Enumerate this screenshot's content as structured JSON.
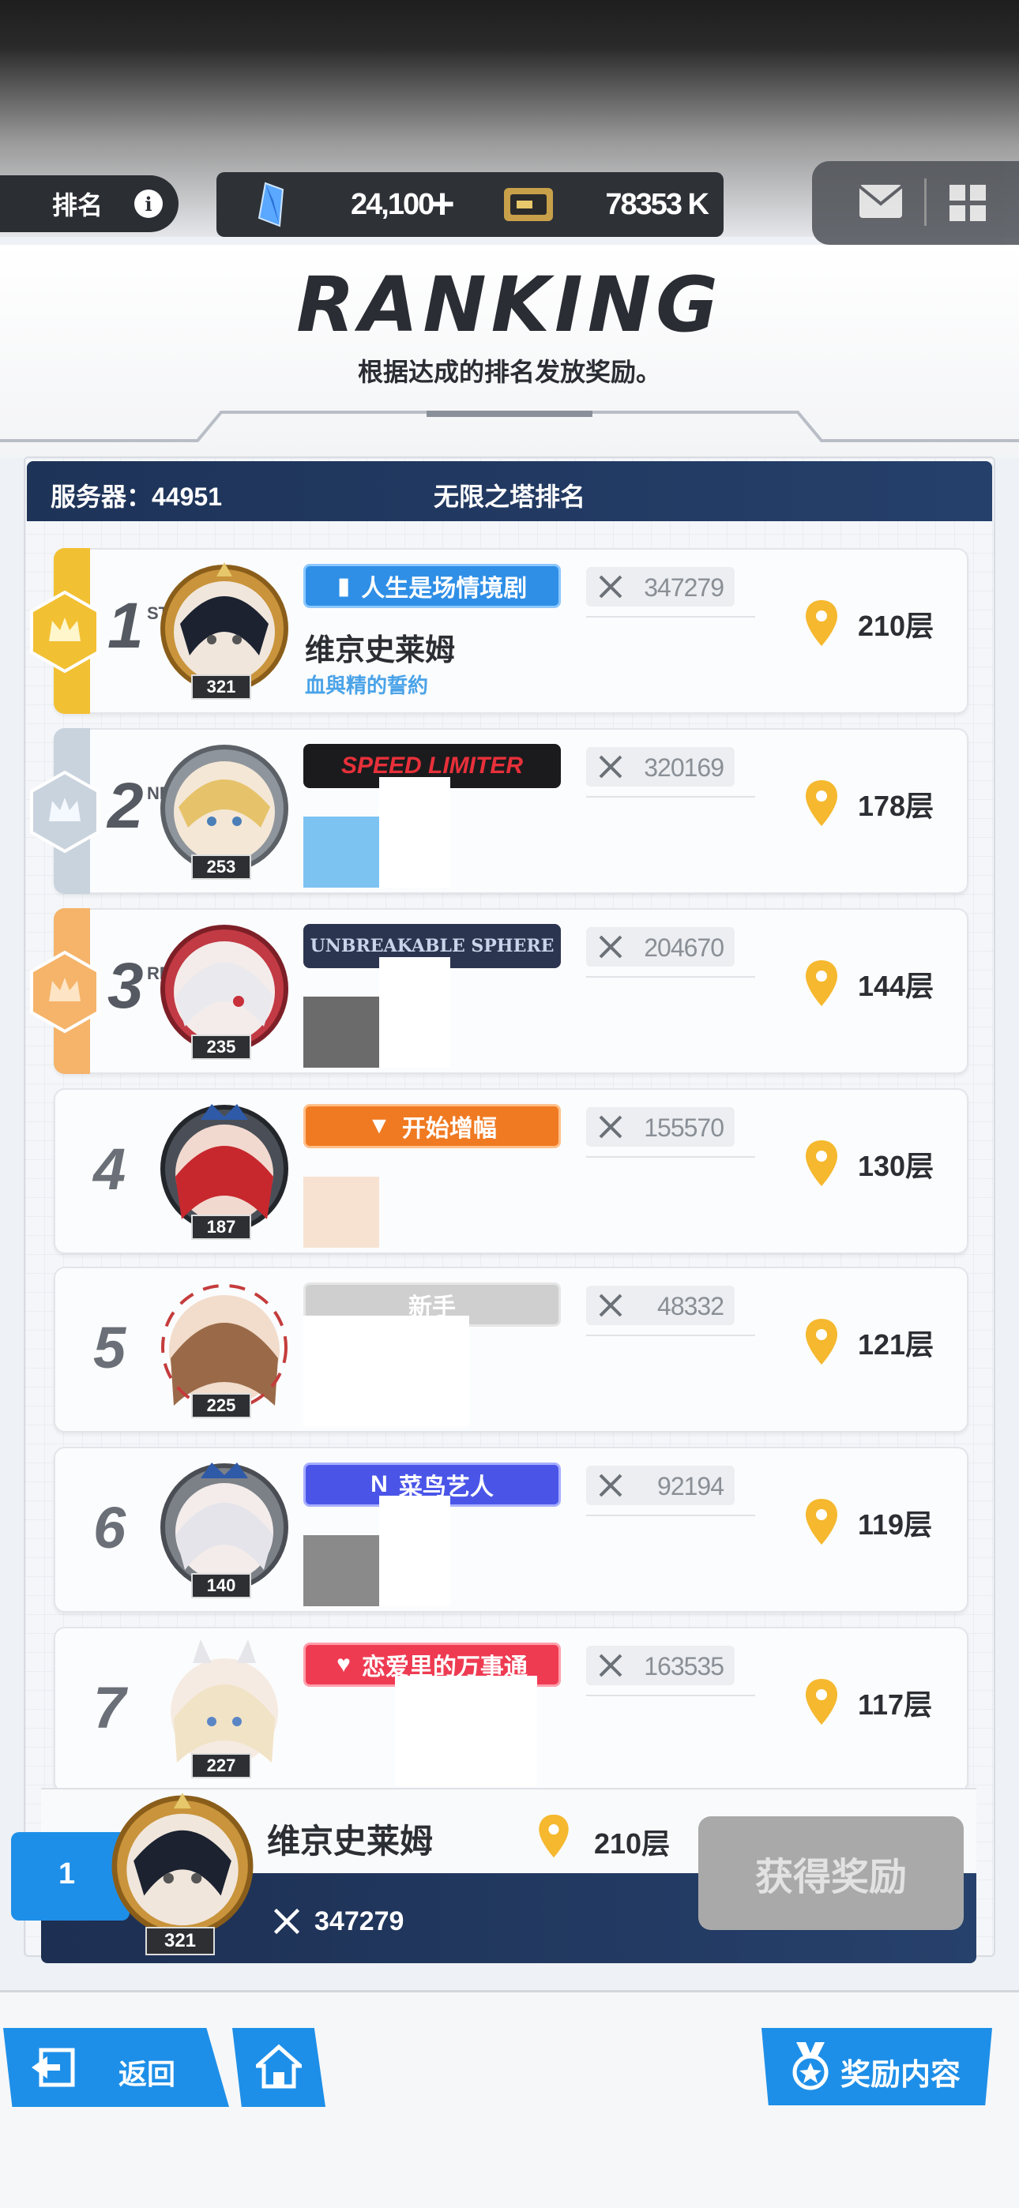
{
  "hud": {
    "rank_tab": "排名",
    "info_icon": "i",
    "gems": "24,100",
    "gems_plus": "+",
    "cards": "78353 K"
  },
  "header": {
    "title": "RANKING",
    "subtitle": "根据达成的排名发放奖励。"
  },
  "board": {
    "server": "服务器：44951",
    "title": "无限之塔排名"
  },
  "rows": [
    {
      "rank": "1",
      "sup": "ST",
      "level": "321",
      "badge": "人生是场情境剧",
      "power": "347279",
      "name": "维京史莱姆",
      "guild": "血與精的誓約",
      "floor": "210层"
    },
    {
      "rank": "2",
      "sup": "ND",
      "level": "253",
      "badge": "SPEED LIMITER",
      "power": "320169",
      "floor": "178层"
    },
    {
      "rank": "3",
      "sup": "RD",
      "level": "235",
      "badge": "UNBREAKABLE SPHERE",
      "power": "204670",
      "floor": "144层"
    },
    {
      "rank": "4",
      "level": "187",
      "badge": "开始增幅",
      "power": "155570",
      "floor": "130层"
    },
    {
      "rank": "5",
      "level": "225",
      "badge": "新手",
      "power": "48332",
      "floor": "121层"
    },
    {
      "rank": "6",
      "level": "140",
      "badge": "菜鸟艺人",
      "power": "92194",
      "floor": "119层"
    },
    {
      "rank": "7",
      "level": "227",
      "badge": "恋爱里的万事通",
      "power": "163535",
      "floor": "117层"
    }
  ],
  "self": {
    "rank": "1",
    "level": "321",
    "name": "维京史莱姆",
    "floor": "210层",
    "power": "347279",
    "claim_button": "获得奖励"
  },
  "footer": {
    "back": "返回",
    "rewards": "奖励内容"
  },
  "colors": {
    "gold": "#f2c033",
    "silver": "#c9d3de",
    "bronze": "#f5b46a",
    "accent_blue": "#1e8fe8",
    "navy": "#1e3358",
    "pin": "#f5b82e"
  }
}
